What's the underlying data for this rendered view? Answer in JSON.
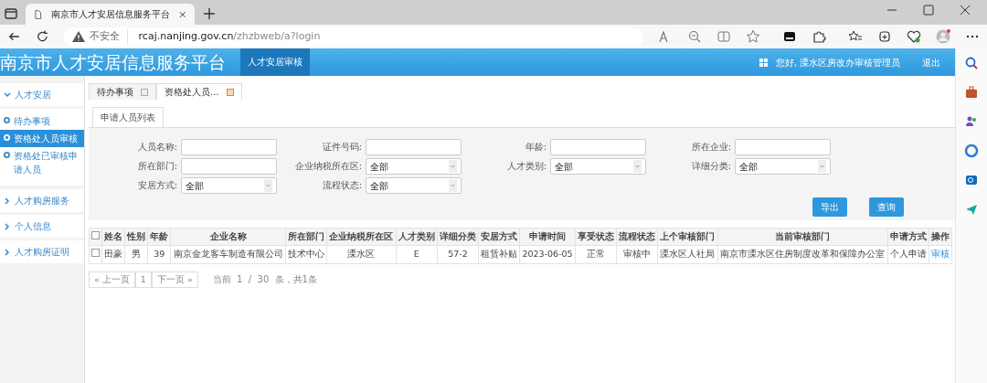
{
  "browser": {
    "tab_title": "南京市人才安居信息服务平台",
    "url_warning": "不安全",
    "url_host": "rcaj.nanjing.gov.cn",
    "url_path": "/zhzbweb/a?login"
  },
  "header": {
    "title": "南京市人才安居信息服务平台",
    "nav": [
      {
        "label": "人才安居审核",
        "selected": true
      }
    ],
    "user": "您好, 溧水区房改办审核管理员",
    "logout": "退出"
  },
  "sidebar": [
    {
      "label": "人才安居",
      "expanded": true,
      "items": [
        {
          "label": "待办事项",
          "selected": false
        },
        {
          "label": "资格处人员审核",
          "selected": true
        },
        {
          "label": "资格处已审核申请人员",
          "selected": false
        }
      ]
    },
    {
      "label": "人才购房服务",
      "expanded": false
    },
    {
      "label": "个人信息",
      "expanded": false
    },
    {
      "label": "人才购房证明",
      "expanded": false
    }
  ],
  "tabs": [
    {
      "label": "待办事项",
      "selected": false
    },
    {
      "label": "资格处人员...",
      "selected": true
    }
  ],
  "subtab": "申请人员列表",
  "filters": [
    {
      "label": "人员名称:",
      "kind": "text"
    },
    {
      "label": "证件号码:",
      "kind": "text"
    },
    {
      "label": "年龄:",
      "kind": "text"
    },
    {
      "label": "所在企业:",
      "kind": "text"
    },
    {
      "label": "所在部门:",
      "kind": "text"
    },
    {
      "label": "企业纳税所在区:",
      "kind": "select",
      "value": "全部"
    },
    {
      "label": "人才类别:",
      "kind": "select",
      "value": "全部"
    },
    {
      "label": "详细分类:",
      "kind": "select",
      "value": "全部"
    },
    {
      "label": "安居方式:",
      "kind": "select",
      "value": "全部"
    },
    {
      "label": "流程状态:",
      "kind": "select",
      "value": "全部"
    }
  ],
  "buttons": [
    "导出",
    "查询"
  ],
  "table": {
    "all_checked": false,
    "columns": [
      "姓名",
      "性别",
      "年龄",
      "企业名称",
      "所在部门",
      "企业纳税所在区",
      "人才类别",
      "详细分类",
      "安居方式",
      "申请时间",
      "享受状态",
      "流程状态",
      "上个审核部门",
      "当前审核部门",
      "申请方式",
      "操作"
    ],
    "rows": [
      {
        "checked": false,
        "cells": [
          "田豪",
          "男",
          "39",
          "南京金龙客车制造有限公司",
          "技术中心",
          "溧水区",
          "E",
          "57-2",
          "租赁补贴",
          "2023-06-05",
          "正常",
          "审核中",
          "溧水区人社局",
          "南京市溧水区住房制度改革和保障办公室",
          "个人申请",
          "审核"
        ]
      }
    ]
  },
  "pagination": {
    "prev": "« 上一页",
    "page": "1",
    "next": "下一页 »",
    "info": "当前  1  /  30  条，共1条"
  }
}
